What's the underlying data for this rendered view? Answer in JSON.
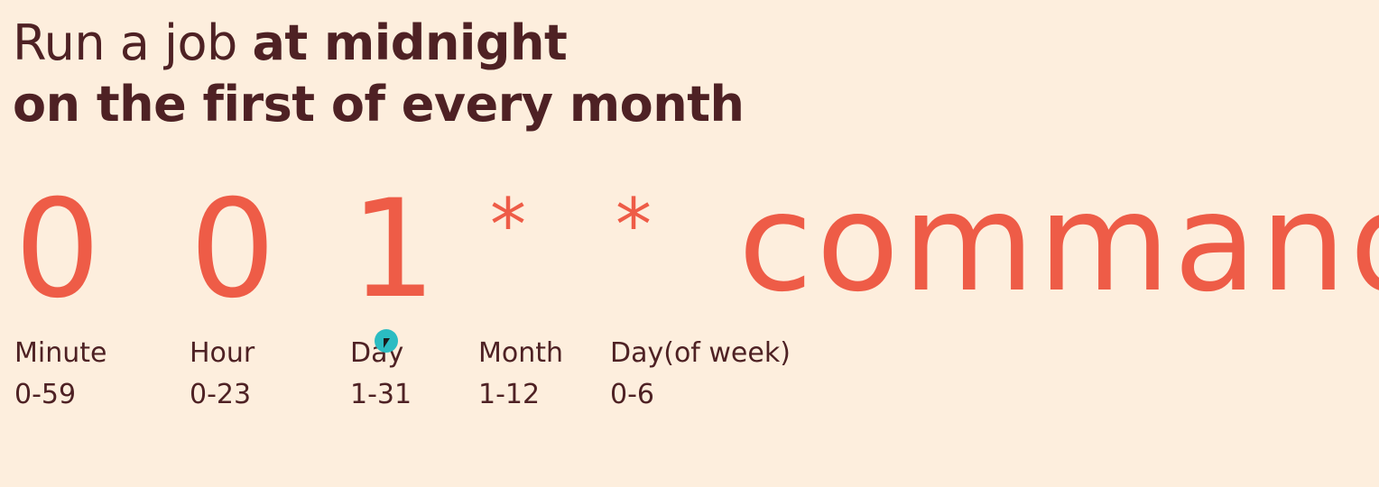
{
  "heading": {
    "line1_normal": "Run a job ",
    "line1_bold": "at midnight",
    "line2_bold": "on the first of every month"
  },
  "fields": [
    {
      "value": "0",
      "name": "Minute",
      "range": "0-59"
    },
    {
      "value": "0",
      "name": "Hour",
      "range": "0-23"
    },
    {
      "value": "1",
      "name": "Day",
      "range": "1-31"
    },
    {
      "value": "*",
      "name": "Month",
      "range": "1-12"
    },
    {
      "value": "*",
      "name": "Day(of week)",
      "range": "0-6"
    }
  ],
  "command": "command",
  "colors": {
    "background": "#fdeedd",
    "accent": "#ee5c47",
    "text": "#4e2124",
    "cursor": "#2bbcc2"
  }
}
